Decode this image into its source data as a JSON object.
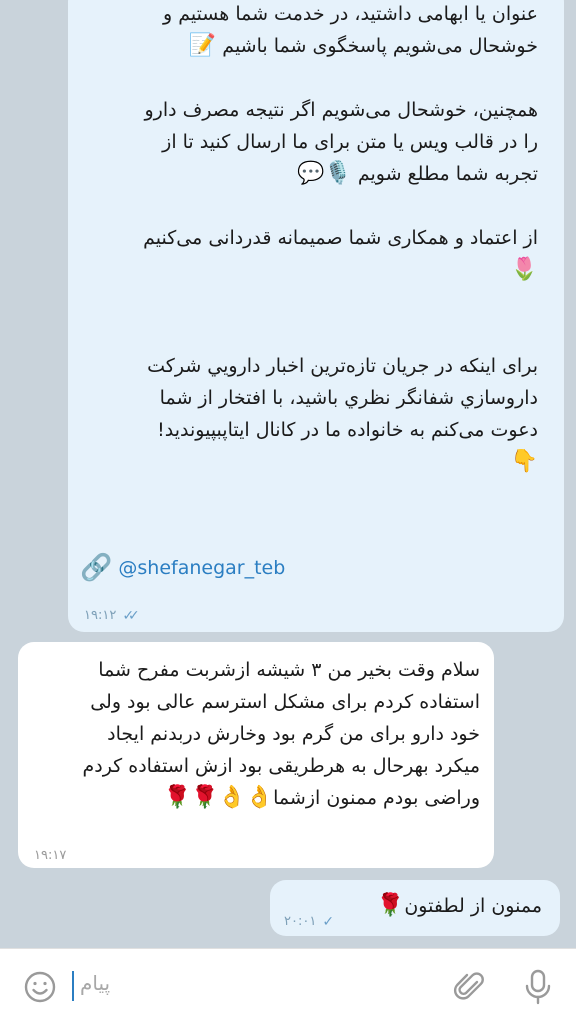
{
  "messages": {
    "m1": {
      "lines_top": [
        "عنوان یا ابهامی داشتید، در خدمت شما هستیم و",
        "خوشحال می‌شویم پاسخگوی شما باشیم ",
        "همچنین، خوشحال می‌شویم اگر نتیجه مصرف دارو",
        "را در قالب ویس یا متن برای ما ارسال کنید تا از",
        "تجربه شما مطلع شویم ",
        "از اعتماد و همکاری شما صمیمانه قدردانی می‌کنیم",
        "برای اینکه در جریان تازه‌ترین اخبار دارویي شرکت",
        "داروسازي شفانگر نظري باشید، با افتخار از شما",
        "دعوت می‌کنم به خانواده ما در کانال ایتاپبپیوندید!"
      ],
      "emoji_memo": "📝",
      "emoji_voice": "🎙️💬",
      "emoji_tulip": "🌷",
      "emoji_point": "👇",
      "link_text": "@shefanegar_teb",
      "link_emoji": "🔗",
      "time": "۱۹:۱۲",
      "ticks": "✓✓"
    },
    "m2": {
      "lines": [
        "سلام وقت بخیر من ۳ شیشه ازشربت مفرح شما",
        "استفاده کردم برای مشکل استرسم عالی بود ولی",
        "خود دارو برای من گرم بود وخارش دربدنم ایجاد",
        "میکرد بهرحال به هرطریقی بود ازش استفاده کردم",
        "وراضی بودم ممنون ازشما"
      ],
      "emojis": "👌👌🌹🌹",
      "time": "۱۹:۱۷"
    },
    "m3": {
      "text": "ممنون از لطفتون",
      "emoji": "🌹",
      "time": "۲۰:۰۱",
      "ticks": "✓"
    }
  },
  "composer": {
    "placeholder": "پیام",
    "icons": {
      "emoji": "smiley-icon",
      "attach": "paperclip-icon",
      "mic": "microphone-icon"
    }
  },
  "colors": {
    "background": "#c9d3db",
    "outgoing_bubble": "#e6f2fb",
    "incoming_bubble": "#ffffff",
    "link": "#2b7ec2"
  }
}
